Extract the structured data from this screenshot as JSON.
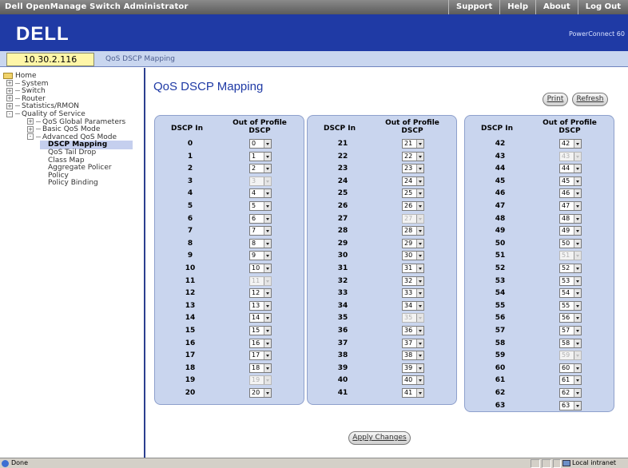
{
  "window": {
    "title": "Dell OpenManage Switch Administrator"
  },
  "top_links": [
    "Support",
    "Help",
    "About",
    "Log Out"
  ],
  "banner": {
    "logo": "DELL",
    "product": "PowerConnect 60"
  },
  "ip": "10.30.2.116",
  "breadcrumb": "QoS DSCP Mapping",
  "tree": [
    {
      "label": "Home",
      "level": 0,
      "exp": "",
      "icon": "folder-icon"
    },
    {
      "label": "System",
      "level": 1,
      "exp": "+"
    },
    {
      "label": "Switch",
      "level": 1,
      "exp": "+"
    },
    {
      "label": "Router",
      "level": 1,
      "exp": "+"
    },
    {
      "label": "Statistics/RMON",
      "level": 1,
      "exp": "+"
    },
    {
      "label": "Quality of Service",
      "level": 1,
      "exp": "-"
    },
    {
      "label": "QoS Global Parameters",
      "level": 2,
      "exp": "+"
    },
    {
      "label": "Basic QoS Mode",
      "level": 2,
      "exp": "+"
    },
    {
      "label": "Advanced QoS Mode",
      "level": 2,
      "exp": "-"
    },
    {
      "label": "DSCP Mapping",
      "level": 3,
      "exp": "",
      "selected": true
    },
    {
      "label": "QoS Tail Drop",
      "level": 3,
      "exp": ""
    },
    {
      "label": "Class Map",
      "level": 3,
      "exp": ""
    },
    {
      "label": "Aggregate Policer",
      "level": 3,
      "exp": ""
    },
    {
      "label": "Policy",
      "level": 3,
      "exp": ""
    },
    {
      "label": "Policy Binding",
      "level": 3,
      "exp": ""
    }
  ],
  "page": {
    "title": "QoS DSCP Mapping",
    "print_label": "Print",
    "refresh_label": "Refresh",
    "apply_label": "Apply Changes",
    "col_in": "DSCP In",
    "col_out": "Out of Profile DSCP"
  },
  "mapping": [
    {
      "in": 0,
      "out": 0
    },
    {
      "in": 1,
      "out": 1
    },
    {
      "in": 2,
      "out": 2
    },
    {
      "in": 3,
      "out": 3,
      "disabled": true
    },
    {
      "in": 4,
      "out": 4
    },
    {
      "in": 5,
      "out": 5
    },
    {
      "in": 6,
      "out": 6
    },
    {
      "in": 7,
      "out": 7
    },
    {
      "in": 8,
      "out": 8
    },
    {
      "in": 9,
      "out": 9
    },
    {
      "in": 10,
      "out": 10
    },
    {
      "in": 11,
      "out": 11,
      "disabled": true
    },
    {
      "in": 12,
      "out": 12
    },
    {
      "in": 13,
      "out": 13
    },
    {
      "in": 14,
      "out": 14
    },
    {
      "in": 15,
      "out": 15
    },
    {
      "in": 16,
      "out": 16
    },
    {
      "in": 17,
      "out": 17
    },
    {
      "in": 18,
      "out": 18
    },
    {
      "in": 19,
      "out": 19,
      "disabled": true
    },
    {
      "in": 20,
      "out": 20
    },
    {
      "in": 21,
      "out": 21
    },
    {
      "in": 22,
      "out": 22
    },
    {
      "in": 23,
      "out": 23
    },
    {
      "in": 24,
      "out": 24
    },
    {
      "in": 25,
      "out": 25
    },
    {
      "in": 26,
      "out": 26
    },
    {
      "in": 27,
      "out": 27,
      "disabled": true
    },
    {
      "in": 28,
      "out": 28
    },
    {
      "in": 29,
      "out": 29
    },
    {
      "in": 30,
      "out": 30
    },
    {
      "in": 31,
      "out": 31
    },
    {
      "in": 32,
      "out": 32
    },
    {
      "in": 33,
      "out": 33
    },
    {
      "in": 34,
      "out": 34
    },
    {
      "in": 35,
      "out": 35,
      "disabled": true
    },
    {
      "in": 36,
      "out": 36
    },
    {
      "in": 37,
      "out": 37
    },
    {
      "in": 38,
      "out": 38
    },
    {
      "in": 39,
      "out": 39
    },
    {
      "in": 40,
      "out": 40
    },
    {
      "in": 41,
      "out": 41
    },
    {
      "in": 42,
      "out": 42
    },
    {
      "in": 43,
      "out": 43,
      "disabled": true
    },
    {
      "in": 44,
      "out": 44
    },
    {
      "in": 45,
      "out": 45
    },
    {
      "in": 46,
      "out": 46
    },
    {
      "in": 47,
      "out": 47
    },
    {
      "in": 48,
      "out": 48
    },
    {
      "in": 49,
      "out": 49
    },
    {
      "in": 50,
      "out": 50
    },
    {
      "in": 51,
      "out": 51,
      "disabled": true
    },
    {
      "in": 52,
      "out": 52
    },
    {
      "in": 53,
      "out": 53
    },
    {
      "in": 54,
      "out": 54
    },
    {
      "in": 55,
      "out": 55
    },
    {
      "in": 56,
      "out": 56
    },
    {
      "in": 57,
      "out": 57
    },
    {
      "in": 58,
      "out": 58
    },
    {
      "in": 59,
      "out": 59,
      "disabled": true
    },
    {
      "in": 60,
      "out": 60
    },
    {
      "in": 61,
      "out": 61
    },
    {
      "in": 62,
      "out": 62
    },
    {
      "in": 63,
      "out": 63
    }
  ],
  "status": {
    "text": "Done",
    "zone": "Local intranet"
  },
  "colors": {
    "banner": "#1f3aa5",
    "panel": "#c9d5ee",
    "ip_box": "#fff6a8",
    "title": "#1f3aa5"
  }
}
